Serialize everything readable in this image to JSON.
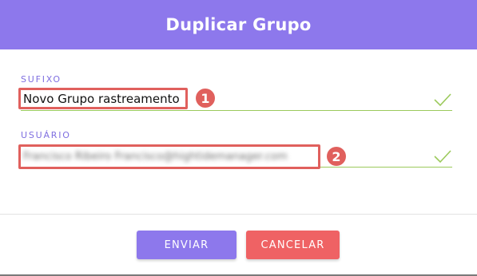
{
  "dialog": {
    "title": "Duplicar Grupo"
  },
  "fields": {
    "suffix": {
      "label": "SUFIXO",
      "value": "Novo Grupo rastreamento",
      "badge": "1"
    },
    "user": {
      "label": "USUÁRIO",
      "value": "Francisco Ribeiro Francisco@hightidemanager.com",
      "badge": "2"
    }
  },
  "buttons": {
    "send_label": "ENVIAR",
    "cancel_label": "CANCELAR"
  },
  "colors": {
    "primary": "#8d78ec",
    "danger": "#ef6264",
    "valid": "#9cca5c",
    "annotation": "#e0605d"
  },
  "icons": {
    "valid": "check-icon"
  }
}
